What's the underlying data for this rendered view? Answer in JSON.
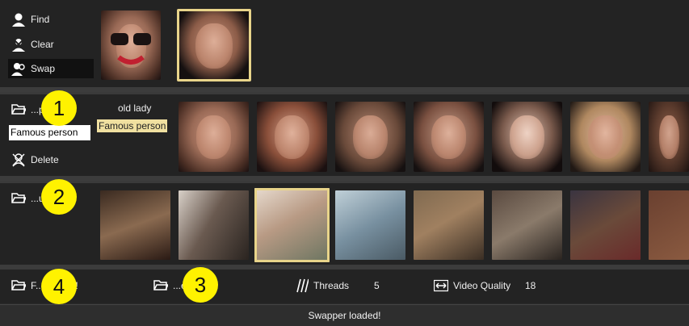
{
  "top": {
    "find_label": "Find",
    "clear_label": "Clear",
    "swap_label": "Swap"
  },
  "faces": {
    "folder_label": "...p...2",
    "name_input_value": "Famous person",
    "delete_label": "Delete",
    "tags": [
      "old lady",
      "Famous person"
    ]
  },
  "targets": {
    "folder_label": "...u...2"
  },
  "bottom": {
    "faces_status": "F... loaded!",
    "output_label": "...e... ut",
    "threads_label": "Threads",
    "threads_value": "5",
    "video_quality_label": "Video Quality",
    "video_quality_value": "18"
  },
  "status": "Swapper loaded!",
  "markers": [
    "1",
    "2",
    "3",
    "4"
  ],
  "colors": {
    "selection": "#e8d48a",
    "marker": "#fff200",
    "tag_highlight": "#f0e0a0"
  }
}
